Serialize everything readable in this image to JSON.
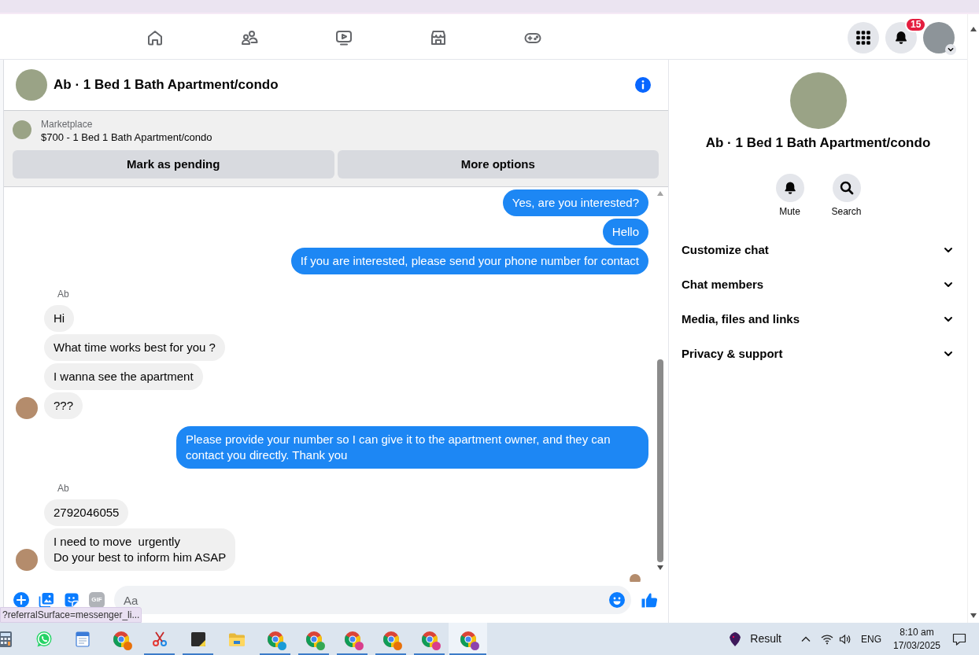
{
  "top_nav": {
    "tabs": [
      {
        "kind": "home",
        "selected": false
      },
      {
        "kind": "friends",
        "selected": false
      },
      {
        "kind": "video",
        "selected": false
      },
      {
        "kind": "marketplace",
        "selected": false
      },
      {
        "kind": "gaming",
        "selected": false
      }
    ],
    "notifications_badge": "15"
  },
  "chat": {
    "title": "Ab · 1 Bed 1 Bath Apartment/condo",
    "listing": {
      "label": "Marketplace",
      "summary": "$700 - 1 Bed 1 Bath Apartment/condo",
      "actions": [
        "Mark as pending",
        "More options"
      ]
    },
    "messages": [
      {
        "kind": "outgoing",
        "text": "Yes, are you interested?"
      },
      {
        "kind": "outgoing",
        "text": "Hello"
      },
      {
        "kind": "outgoing",
        "text": "If you are interested, please send your phone number for contact"
      },
      {
        "kind": "sender",
        "text": "Ab"
      },
      {
        "kind": "incoming",
        "text": "Hi",
        "avatar": false
      },
      {
        "kind": "incoming",
        "text": "What time works best for you ?",
        "avatar": false
      },
      {
        "kind": "incoming",
        "text": "I wanna see the apartment",
        "avatar": false
      },
      {
        "kind": "incoming",
        "text": "???",
        "avatar": true
      },
      {
        "kind": "outgoing",
        "text": "Please provide your number so I can give it to the apartment owner, and they can contact you directly. Thank you"
      },
      {
        "kind": "sender",
        "text": "Ab"
      },
      {
        "kind": "incoming",
        "text": "2792046055",
        "avatar": false
      },
      {
        "kind": "incoming",
        "text": "I need to move  urgently\nDo your best to inform him ASAP",
        "avatar": true
      }
    ],
    "read_receipt": true,
    "composer": {
      "gif_label": "GIF",
      "placeholder": "Aa"
    }
  },
  "link_status": "?referralSurface=messenger_li...",
  "details_panel": {
    "title": "Ab · 1 Bed 1 Bath Apartment/condo",
    "actions": [
      {
        "kind": "mute",
        "label": "Mute"
      },
      {
        "kind": "search",
        "label": "Search"
      }
    ],
    "sections": [
      {
        "label": "Customize chat",
        "expanded": false
      },
      {
        "label": "Chat members",
        "expanded": false
      },
      {
        "label": "Media, files and links",
        "expanded": false
      },
      {
        "label": "Privacy & support",
        "expanded": false
      }
    ]
  },
  "taskbar": {
    "apps": [
      {
        "kind": "calculator",
        "running": false,
        "selected": false
      },
      {
        "kind": "whatsapp",
        "running": false,
        "selected": false
      },
      {
        "kind": "wordpad",
        "running": false,
        "selected": false
      },
      {
        "kind": "chrome",
        "running": false,
        "selected": false,
        "color": "#e8710a"
      },
      {
        "kind": "snipping",
        "running": true,
        "selected": false
      },
      {
        "kind": "sticky",
        "running": true,
        "selected": false
      },
      {
        "kind": "explorer",
        "running": false,
        "selected": false
      },
      {
        "kind": "chrome",
        "running": true,
        "selected": false,
        "color": "#1a9bd7"
      },
      {
        "kind": "chrome",
        "running": true,
        "selected": false,
        "color": "#34a853"
      },
      {
        "kind": "chrome",
        "running": true,
        "selected": false,
        "color": "#d93e8c"
      },
      {
        "kind": "chrome",
        "running": true,
        "selected": false,
        "color": "#e8710a"
      },
      {
        "kind": "chrome",
        "running": true,
        "selected": false,
        "color": "#d93e8c"
      },
      {
        "kind": "chrome",
        "running": true,
        "selected": true,
        "color": "#8e44ad"
      }
    ],
    "widget": "Result",
    "language": "ENG",
    "time": "8:10 am",
    "date": "17/03/2025"
  }
}
